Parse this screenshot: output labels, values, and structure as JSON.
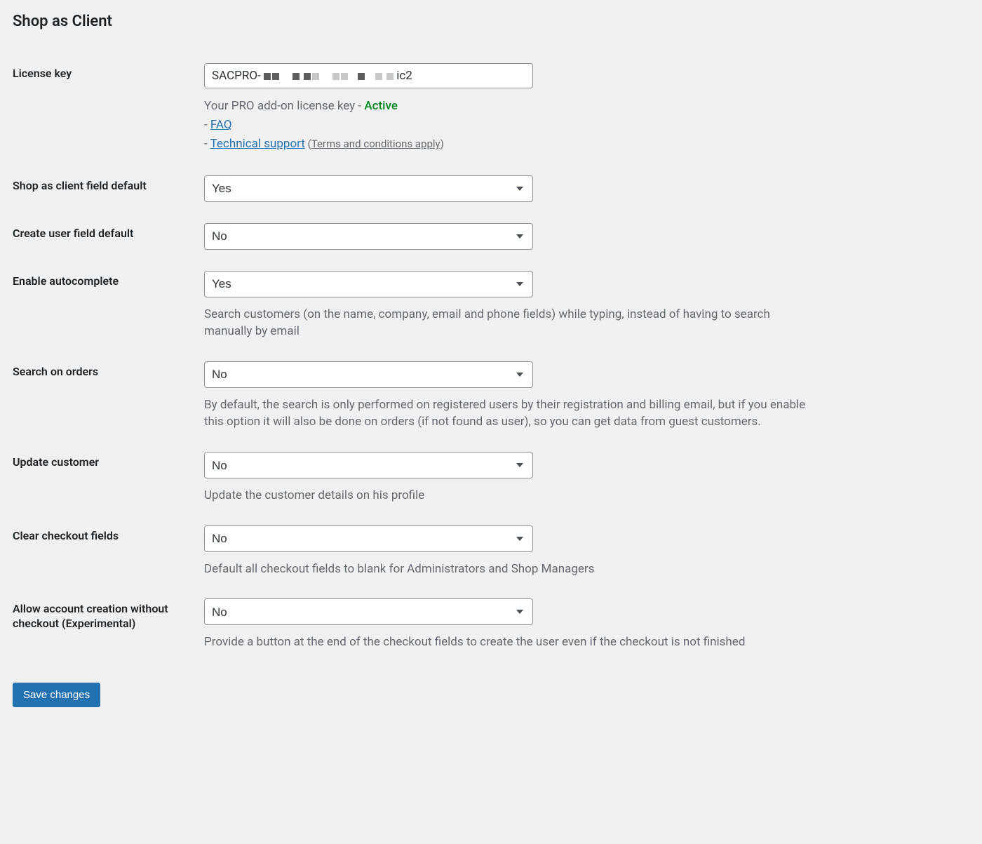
{
  "page_title": "Shop as Client",
  "fields": {
    "license_key": {
      "label": "License key",
      "value_prefix": "SACPRO-",
      "value_suffix": "ic2",
      "desc_prefix": "Your PRO add-on license key - ",
      "status": "Active",
      "bullet_prefix": "- ",
      "faq_link": "FAQ",
      "support_link": "Technical support",
      "paren_open": " (",
      "terms_link": "Terms and conditions apply",
      "paren_close": ")"
    },
    "shop_as_client_default": {
      "label": "Shop as client field default",
      "value": "Yes"
    },
    "create_user_default": {
      "label": "Create user field default",
      "value": "No"
    },
    "enable_autocomplete": {
      "label": "Enable autocomplete",
      "value": "Yes",
      "description": "Search customers (on the name, company, email and phone fields) while typing, instead of having to search manually by email"
    },
    "search_on_orders": {
      "label": "Search on orders",
      "value": "No",
      "description": "By default, the search is only performed on registered users by their registration and billing email, but if you enable this option it will also be done on orders (if not found as user), so you can get data from guest customers."
    },
    "update_customer": {
      "label": "Update customer",
      "value": "No",
      "description": "Update the customer details on his profile"
    },
    "clear_checkout_fields": {
      "label": "Clear checkout fields",
      "value": "No",
      "description": "Default all checkout fields to blank for Administrators and Shop Managers"
    },
    "allow_account_creation": {
      "label": "Allow account creation without checkout (Experimental)",
      "value": "No",
      "description": "Provide a button at the end of the checkout fields to create the user even if the checkout is not finished"
    }
  },
  "save_button": "Save changes"
}
